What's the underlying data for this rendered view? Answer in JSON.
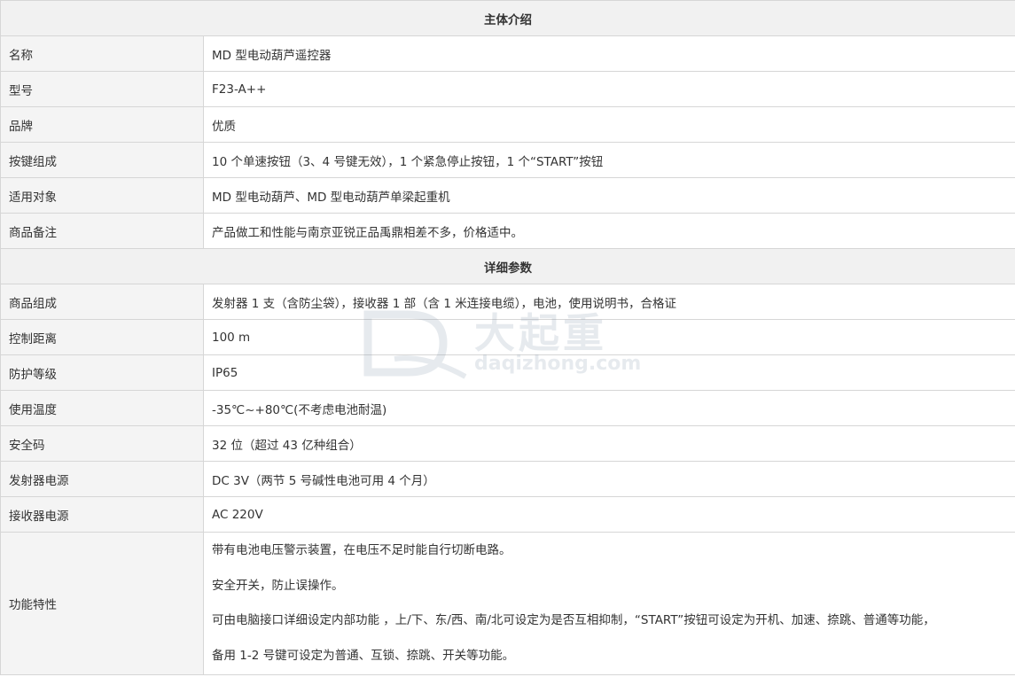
{
  "section_intro": {
    "title": "主体介绍",
    "rows": [
      {
        "label": "名称",
        "value": "MD 型电动葫芦遥控器"
      },
      {
        "label": "型号",
        "value": "F23-A++"
      },
      {
        "label": "品牌",
        "value": "优质"
      },
      {
        "label": "按键组成",
        "value": "10 个单速按钮（3、4 号键无效），1 个紧急停止按钮，1 个“START”按钮"
      },
      {
        "label": "适用对象",
        "value": "MD 型电动葫芦、MD 型电动葫芦单梁起重机"
      },
      {
        "label": "商品备注",
        "value": "产品做工和性能与南京亚锐正品禹鼎相差不多，价格适中。"
      }
    ]
  },
  "section_params": {
    "title": "详细参数",
    "rows": [
      {
        "label": "商品组成",
        "value": "发射器 1 支（含防尘袋），接收器 1 部（含 1 米连接电缆），电池，使用说明书，合格证"
      },
      {
        "label": "控制距离",
        "value": "100 m"
      },
      {
        "label": "防护等级",
        "value": "IP65"
      },
      {
        "label": "使用温度",
        "value": "-35℃~+80℃(不考虑电池耐温)"
      },
      {
        "label": "安全码",
        "value": "32 位（超过 43 亿种组合）"
      },
      {
        "label": "发射器电源",
        "value": "DC 3V（两节 5 号碱性电池可用 4 个月）"
      },
      {
        "label": "接收器电源",
        "value": "AC 220V"
      }
    ],
    "features": {
      "label": "功能特性",
      "lines": [
        "带有电池电压警示装置，在电压不足时能自行切断电路。",
        "安全开关，防止误操作。",
        "可由电脑接口详细设定内部功能 ，上/下、东/西、南/北可设定为是否互相抑制，“START”按钮可设定为开机、加速、捺跳、普通等功能，",
        "备用 1-2 号键可设定为普通、互锁、捺跳、开关等功能。"
      ]
    }
  },
  "watermark": {
    "text_cn": "大起重",
    "text_en": "daqizhong.com"
  }
}
